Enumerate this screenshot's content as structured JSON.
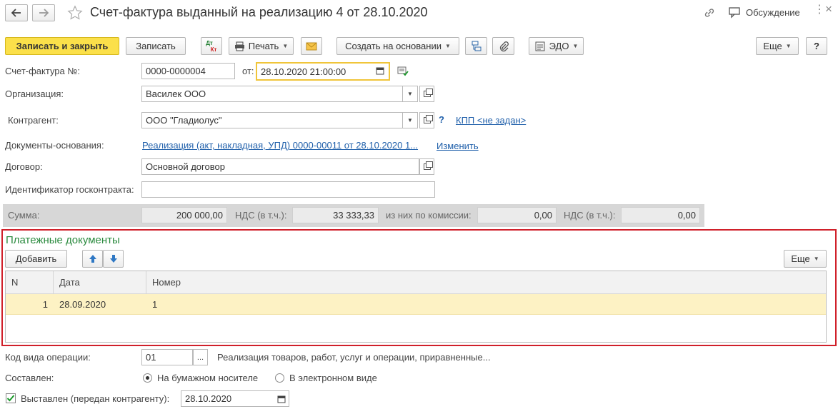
{
  "window": {
    "title": "Счет-фактура выданный на реализацию 4 от 28.10.2020",
    "discussion_label": "Обсуждение"
  },
  "toolbar": {
    "save_close": "Записать и закрыть",
    "save": "Записать",
    "dtkt_top": "Дт",
    "dtkt_bottom": "Кт",
    "print": "Печать",
    "create_based": "Создать на основании",
    "edo": "ЭДО",
    "more": "Еще",
    "help": "?"
  },
  "form": {
    "invoice_number_label": "Счет-фактура №:",
    "invoice_number": "0000-0000004",
    "date_label": "от:",
    "date_value": "28.10.2020 21:00:00",
    "organization_label": "Организация:",
    "organization": "Василек ООО",
    "counterparty_label": "Контрагент:",
    "counterparty": "ООО \"Гладиолус\"",
    "question": "?",
    "kpp_link": "КПП <не задан>",
    "base_docs_label": "Документы-основания:",
    "base_docs_link": "Реализация (акт, накладная, УПД) 0000-00011 от 28.10.2020 1...",
    "change_link": "Изменить",
    "contract_label": "Договор:",
    "contract": "Основной договор",
    "gov_contract_label": "Идентификатор госконтракта:",
    "gov_contract": ""
  },
  "sums": {
    "sum_label": "Сумма:",
    "sum": "200 000,00",
    "vat_label": "НДС (в т.ч.):",
    "vat": "33 333,33",
    "commission_label": "из них по комиссии:",
    "commission": "0,00",
    "vat2_label": "НДС (в т.ч.):",
    "vat2": "0,00"
  },
  "payments": {
    "title": "Платежные документы",
    "add_label": "Добавить",
    "more_label": "Еще",
    "columns": [
      "N",
      "Дата",
      "Номер"
    ],
    "rows": [
      {
        "n": "1",
        "date": "28.09.2020",
        "number": "1"
      }
    ]
  },
  "bottom": {
    "op_code_label": "Код вида операции:",
    "op_code": "01",
    "op_code_btn": "...",
    "op_code_desc": "Реализация товаров, работ, услуг и операции, приравненные...",
    "composed_label": "Составлен:",
    "paper_label": "На бумажном носителе",
    "electronic_label": "В электронном виде",
    "issued_label": "Выставлен (передан контрагенту):",
    "issued_date": "28.10.2020"
  },
  "colors": {
    "accent_yellow": "#fbe04a",
    "highlight_border": "#d0202a",
    "section_title": "#2a8a3e",
    "selected_row": "#fdf2c4",
    "link": "#1f5faa"
  }
}
